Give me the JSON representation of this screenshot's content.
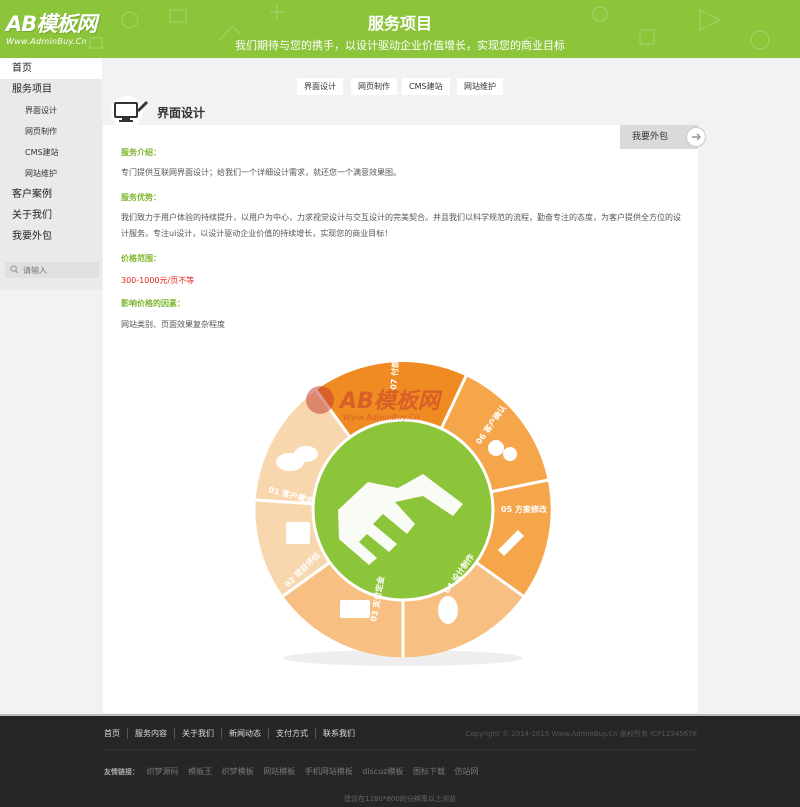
{
  "header": {
    "logo_text": "AB模板网",
    "logo_sub": "Www.AdminBuy.Cn",
    "title": "服务项目",
    "slogan": "我们期待与您的携手，以设计驱动企业价值增长，实现您的商业目标"
  },
  "sidebar": {
    "items": [
      {
        "label": "首页"
      },
      {
        "label": "服务项目"
      },
      {
        "label": "界面设计"
      },
      {
        "label": "网页制作"
      },
      {
        "label": "CMS建站"
      },
      {
        "label": "网站维护"
      },
      {
        "label": "客户案例"
      },
      {
        "label": "关于我们"
      },
      {
        "label": "我要外包"
      }
    ],
    "search_placeholder": "请输入"
  },
  "tabs": [
    "界面设计",
    "网页制作",
    "CMS建站",
    "网站维护"
  ],
  "section": {
    "title": "界面设计",
    "outsource_label": "我要外包"
  },
  "content": {
    "intro_label": "服务介绍：",
    "intro_text": "专门提供互联网界面设计；给我们一个详细设计需求，就还您一个满意效果图。",
    "advantage_label": "服务优势：",
    "advantage_text": "我们致力于用户体验的持续提升，以用户为中心，力求视觉设计与交互设计的完美契合。并且我们以科学规范的流程，勤奋专注的态度，为客户提供全方位的设计服务。专注ui设计，以设计驱动企业价值的持续增长，实现您的商业目标！",
    "price_label": "价格范围：",
    "price_value": "300-1000元/页不等",
    "factors_label": "影响价格的因素：",
    "factors_text": "网站类别、页面效果复杂程度"
  },
  "wheel": {
    "steps": [
      "01 客户需求",
      "02 项目评估",
      "03 支付定金",
      "04 设计制作",
      "05 方案修改",
      "06 客户确认",
      "07 付款"
    ],
    "watermark_text": "AB模板网",
    "watermark_sub": "Www.AdminBuy.Cn",
    "colors": {
      "green": "#8cc43a",
      "orange": "#f5a54a",
      "light_orange": "#f9d3a5",
      "deep_orange": "#f08a22"
    }
  },
  "footer": {
    "links": [
      "首页",
      "服务内容",
      "关于我们",
      "新闻动态",
      "支付方式",
      "联系我们"
    ],
    "copyright": "Copyright © 2014-2015 Www.AdminBuy.Cn 版权所有 ICP12345678",
    "friends_label": "友情链接：",
    "friends": [
      "织梦源码",
      "模板王",
      "织梦模板",
      "网站模板",
      "手机网站模板",
      "discuz模板",
      "图标下载",
      "仿站网"
    ],
    "tip": "建议在1280*800的分辨率以上浏览"
  },
  "colors": {
    "brand_green": "#8cc43a",
    "price_red": "#e4271b",
    "footer_bg": "#262626"
  }
}
